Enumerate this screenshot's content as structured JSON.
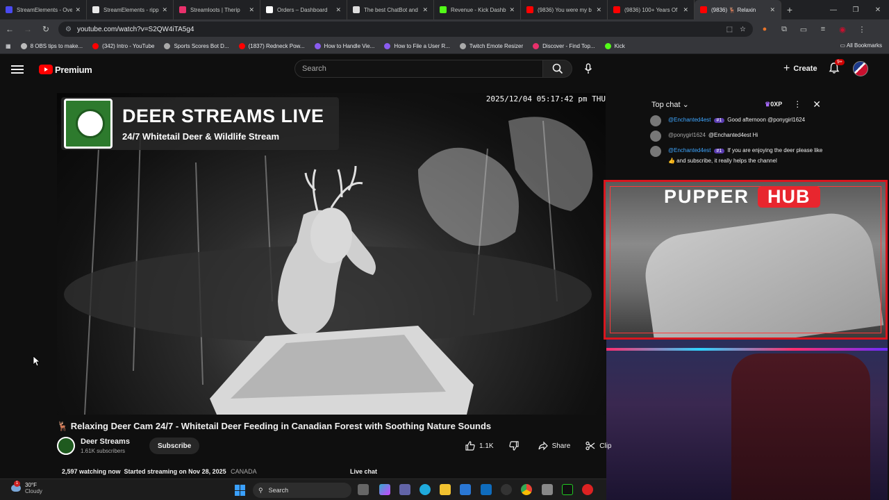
{
  "browser": {
    "tabs": [
      {
        "label": "StreamElements - Ove",
        "color": "#4a4af0"
      },
      {
        "label": "StreamElements - ripp",
        "color": "#e8e8e8"
      },
      {
        "label": "Streamloots | Therip",
        "color": "#e8306b"
      },
      {
        "label": "Orders – Dashboard",
        "color": "#ffffff"
      },
      {
        "label": "The best ChatBot and",
        "color": "#dddddd"
      },
      {
        "label": "Revenue - Kick Dashb",
        "color": "#53fc18"
      },
      {
        "label": "(9836) You were my b",
        "color": "#ff0000"
      },
      {
        "label": "(9836) 100+ Years Of",
        "color": "#ff0000"
      },
      {
        "label": "(9836) 🦌 Relaxin",
        "color": "#ff0000"
      }
    ],
    "active_tab_index": 8,
    "url": "youtube.com/watch?v=S2QW4iTA5g4",
    "bookmarks": [
      {
        "label": "8 OBS tips to make...",
        "color": "#bbbbbb"
      },
      {
        "label": "(342) Intro - YouTube",
        "color": "#ff0000"
      },
      {
        "label": "Sports Scores Bot D...",
        "color": "#aaaaaa"
      },
      {
        "label": "(1837) Redneck Pow...",
        "color": "#ff0000"
      },
      {
        "label": "How to Handle Vie...",
        "color": "#8a5cf0"
      },
      {
        "label": "How to File a User R...",
        "color": "#8a5cf0"
      },
      {
        "label": "Twitch Emote Resizer",
        "color": "#aaaaaa"
      },
      {
        "label": "Discover - Find Top...",
        "color": "#e8306b"
      },
      {
        "label": "Kick",
        "color": "#53fc18"
      }
    ],
    "all_bookmarks": "All Bookmarks"
  },
  "youtube": {
    "logo": "Premium",
    "search_placeholder": "Search",
    "create": "Create",
    "notif_badge": "9+",
    "brand_color": "#ff0000"
  },
  "video": {
    "overlay_title": "DEER STREAMS LIVE",
    "overlay_subtitle": "24/7 Whitetail Deer & Wildlife Stream",
    "timestamp": "2025/12/04 05:17:42 pm THU",
    "title": "🦌 Relaxing Deer Cam 24/7 - Whitetail Deer Feeding in Canadian Forest with Soothing Nature Sounds",
    "channel": "Deer Streams",
    "subscribers": "1.61K subscribers",
    "subscribe": "Subscribe",
    "likes": "1.1K",
    "share": "Share",
    "clip": "Clip",
    "watching": "2,597 watching now",
    "started": "Started streaming on Nov 28, 2025",
    "location": "CANADA",
    "live_chat": "Live chat"
  },
  "chat": {
    "header": "Top chat",
    "xp": "0XP",
    "messages": [
      {
        "author": "@Enchanted4est",
        "rank": "#1",
        "text": "Good afternoon @ponygirl1624"
      },
      {
        "author": "@ponygirl1624",
        "rank": "",
        "text": "@Enchanted4est Hi"
      },
      {
        "author": "@Enchanted4est",
        "rank": "#1",
        "text": "If you are enjoying the deer please like 👍 and subscribe, it really helps the channel"
      }
    ]
  },
  "stream_overlay": {
    "brand_left": "PUPPER",
    "brand_right": "HUB"
  },
  "taskbar": {
    "temperature": "30°F",
    "condition": "Cloudy",
    "weather_badge": "1",
    "search": "Search"
  }
}
